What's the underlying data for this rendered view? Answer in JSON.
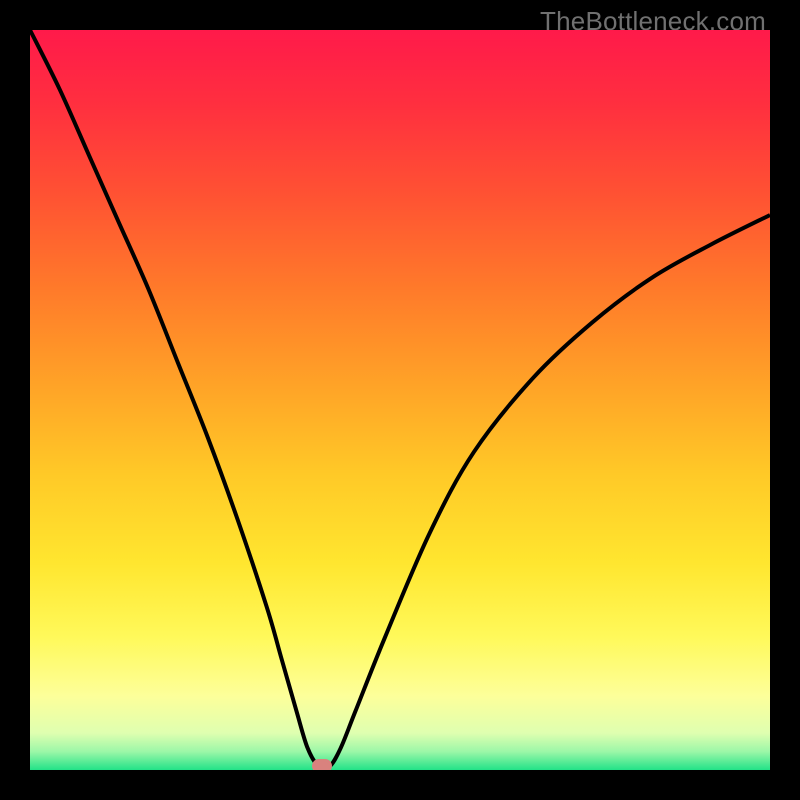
{
  "watermark": "TheBottleneck.com",
  "colors": {
    "curve_stroke": "#000000",
    "dot_fill": "#d9827e",
    "background_black": "#000000"
  },
  "gradient_stops": [
    {
      "offset": 0.0,
      "hex": "#ff1a4a"
    },
    {
      "offset": 0.1,
      "hex": "#ff2f3f"
    },
    {
      "offset": 0.22,
      "hex": "#ff5133"
    },
    {
      "offset": 0.35,
      "hex": "#ff7a2a"
    },
    {
      "offset": 0.48,
      "hex": "#ffa327"
    },
    {
      "offset": 0.6,
      "hex": "#ffc927"
    },
    {
      "offset": 0.72,
      "hex": "#ffe62f"
    },
    {
      "offset": 0.82,
      "hex": "#fff95a"
    },
    {
      "offset": 0.9,
      "hex": "#fdff9a"
    },
    {
      "offset": 0.95,
      "hex": "#dfffb0"
    },
    {
      "offset": 0.975,
      "hex": "#9cf7a8"
    },
    {
      "offset": 1.0,
      "hex": "#22e288"
    }
  ],
  "chart_data": {
    "type": "line",
    "title": "",
    "xlabel": "",
    "ylabel": "",
    "xlim": [
      0,
      100
    ],
    "ylim": [
      0,
      100
    ],
    "x": [
      0,
      4,
      8,
      12,
      16,
      20,
      24,
      28,
      32,
      34,
      36,
      37.5,
      39,
      40.5,
      42,
      44,
      48,
      54,
      60,
      68,
      76,
      84,
      92,
      100
    ],
    "values": [
      100,
      92,
      83,
      74,
      65,
      55,
      45,
      34,
      22,
      15,
      8,
      3,
      0.5,
      0.5,
      3,
      8,
      18,
      32,
      43,
      53,
      60.5,
      66.5,
      71,
      75
    ],
    "annotations": [
      {
        "label": "min-marker",
        "x": 39.5,
        "y": 0.5
      }
    ]
  }
}
